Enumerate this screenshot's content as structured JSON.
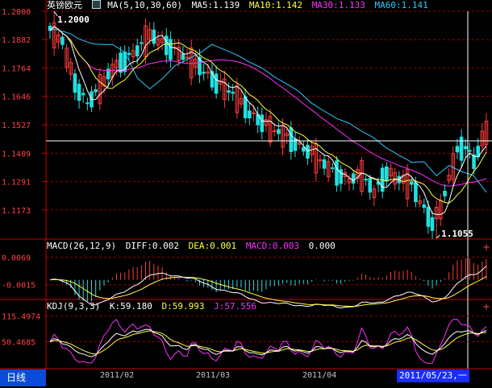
{
  "main": {
    "symbol": "英镑欧元",
    "ma_title": "MA(5,10,30,60)",
    "ma5": "MA5:1.139",
    "ma10": "MA10:1.142",
    "ma30": "MA30:1.133",
    "ma60": "MA60:1.141",
    "y_ticks": [
      "1.2000",
      "1.1882",
      "1.1764",
      "1.1646",
      "1.1527",
      "1.1409",
      "1.1291",
      "1.1173"
    ],
    "high_label": "1.2000",
    "low_label": "1.1055",
    "y_range": [
      1.1055,
      1.2
    ]
  },
  "macd": {
    "title": "MACD(26,12,9)",
    "diff": "DIFF:0.002",
    "dea": "DEA:0.001",
    "macd": "MACD:0.003",
    "extra": "0.000",
    "y_ticks": [
      "0.0069",
      "-0.0015"
    ],
    "y_range": [
      -0.0055,
      0.0085
    ]
  },
  "kdj": {
    "title": "KDJ(9,3,3)",
    "k": "K:59.180",
    "d": "D:59.993",
    "j": "J:57.556",
    "y_ticks": [
      "115.4974",
      "50.4685"
    ],
    "y_range": [
      -14,
      125
    ]
  },
  "x_labels": [
    "2011/02",
    "2011/03",
    "2011/04"
  ],
  "cursor_date": "2011/05/23,一",
  "period_tab": "日线",
  "colors": {
    "up": "#ff3b3b",
    "down": "#20e0e0",
    "ma5": "#ffffff",
    "ma10": "#ffff40",
    "ma30": "#ff30ff",
    "ma60": "#30c8ff",
    "grid": "#9a0000",
    "axis": "#c40000"
  }
}
